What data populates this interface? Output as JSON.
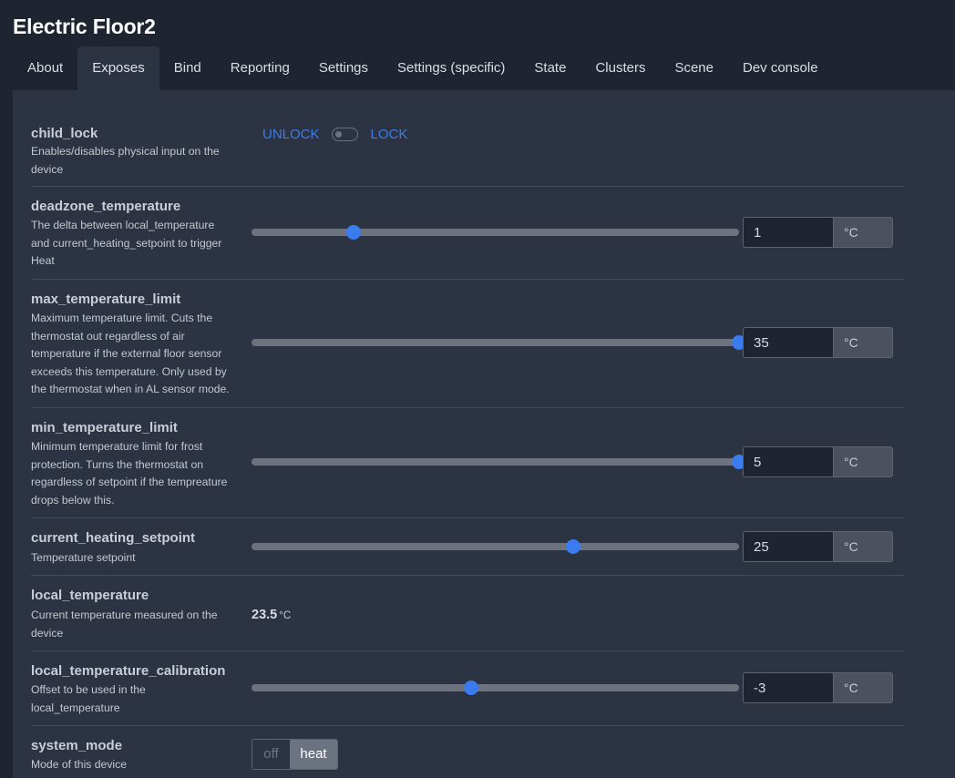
{
  "device_title": "Electric Floor2",
  "tabs": [
    "About",
    "Exposes",
    "Bind",
    "Reporting",
    "Settings",
    "Settings (specific)",
    "State",
    "Clusters",
    "Scene",
    "Dev console"
  ],
  "active_tab": "Exposes",
  "exposes": {
    "child_lock": {
      "name": "child_lock",
      "description": "Enables/disables physical input on the device",
      "off_label": "UNLOCK",
      "on_label": "LOCK",
      "state": "UNLOCK"
    },
    "deadzone_temperature": {
      "name": "deadzone_temperature",
      "description": "The delta between local_temperature and current_heating_setpoint to trigger Heat",
      "value": "1",
      "unit": "°C",
      "slider_fraction": 0.21
    },
    "max_temperature_limit": {
      "name": "max_temperature_limit",
      "description": "Maximum temperature limit. Cuts the thermostat out regardless of air temperature if the external floor sensor exceeds this temperature. Only used by the thermostat when in AL sensor mode.",
      "value": "35",
      "unit": "°C",
      "slider_fraction": 1.0
    },
    "min_temperature_limit": {
      "name": "min_temperature_limit",
      "description": "Minimum temperature limit for frost protection. Turns the thermostat on regardless of setpoint if the tempreature drops below this.",
      "value": "5",
      "unit": "°C",
      "slider_fraction": 1.0
    },
    "current_heating_setpoint": {
      "name": "current_heating_setpoint",
      "description": "Temperature setpoint",
      "value": "25",
      "unit": "°C",
      "slider_fraction": 0.66
    },
    "local_temperature": {
      "name": "local_temperature",
      "description": "Current temperature measured on the device",
      "value": "23.5",
      "unit": "°C"
    },
    "local_temperature_calibration": {
      "name": "local_temperature_calibration",
      "description": "Offset to be used in the local_temperature",
      "value": "-3",
      "unit": "°C",
      "slider_fraction": 0.45
    },
    "system_mode": {
      "name": "system_mode",
      "description": "Mode of this device",
      "options": [
        "off",
        "heat"
      ],
      "selected": "heat"
    }
  },
  "colors": {
    "accent": "#3a7cf0",
    "background": "#1f2530",
    "panel": "#2c3342"
  }
}
